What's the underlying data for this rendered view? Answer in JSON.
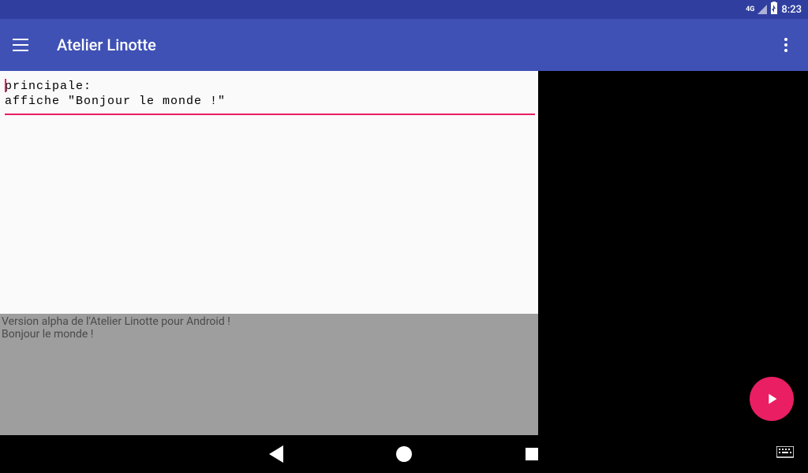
{
  "status": {
    "network_label": "4G",
    "time": "8:23"
  },
  "appbar": {
    "title": "Atelier Linotte"
  },
  "editor": {
    "line1": "principale:",
    "line2": "affiche \"Bonjour le monde !\""
  },
  "console": {
    "line1": "Version alpha de l'Atelier Linotte pour Android !",
    "line2": "Bonjour le monde !"
  }
}
